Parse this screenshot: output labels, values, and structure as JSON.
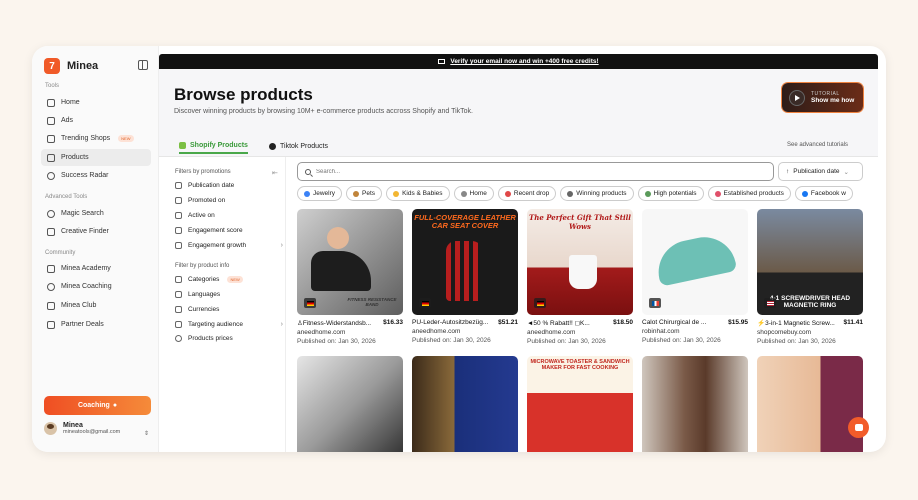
{
  "brand": {
    "name": "Minea",
    "logo_char": "7"
  },
  "sidebar": {
    "tools_label": "Tools",
    "tools": [
      {
        "label": "Home",
        "icon": "home-icon"
      },
      {
        "label": "Ads",
        "icon": "ads-icon"
      },
      {
        "label": "Trending Shops",
        "icon": "shop-icon",
        "badge": "NEW"
      },
      {
        "label": "Products",
        "icon": "products-icon",
        "active": true
      },
      {
        "label": "Success Radar",
        "icon": "radar-icon"
      }
    ],
    "advanced_label": "Advanced Tools",
    "advanced": [
      {
        "label": "Magic Search",
        "icon": "magic-icon"
      },
      {
        "label": "Creative Finder",
        "icon": "creative-icon"
      }
    ],
    "community_label": "Community",
    "community": [
      {
        "label": "Minea Academy",
        "icon": "academy-icon"
      },
      {
        "label": "Minea Coaching",
        "icon": "coaching-icon"
      },
      {
        "label": "Minea Club",
        "icon": "club-icon"
      },
      {
        "label": "Partner Deals",
        "icon": "deals-icon"
      }
    ],
    "coaching_button": "Coaching",
    "user": {
      "name": "Minea",
      "email": "mineatools@gmail.com"
    }
  },
  "banner": {
    "text": "Verify your email now and win +400 free credits!"
  },
  "header": {
    "title": "Browse products",
    "subtitle": "Discover winning products by browsing 10M+ e-commerce products accross Shopify and TikTok.",
    "tutorial_small": "TUTORIAL",
    "tutorial_big": "Show me how",
    "see_advanced": "See advanced tutorials"
  },
  "tabs": [
    {
      "label": "Shopify Products",
      "active": true
    },
    {
      "label": "Tiktok Products",
      "active": false
    }
  ],
  "filters": {
    "promotions_label": "Filters by promotions",
    "promotions": [
      {
        "label": "Publication date"
      },
      {
        "label": "Promoted on"
      },
      {
        "label": "Active on"
      },
      {
        "label": "Engagement score"
      },
      {
        "label": "Engagement growth",
        "chevron": true
      }
    ],
    "info_label": "Filter by product info",
    "info": [
      {
        "label": "Categories",
        "badge": "NEW"
      },
      {
        "label": "Languages"
      },
      {
        "label": "Currencies"
      },
      {
        "label": "Targeting audience",
        "chevron": true
      },
      {
        "label": "Products prices"
      }
    ]
  },
  "search": {
    "placeholder": "Search...",
    "sort_label": "Publication date"
  },
  "chips": [
    {
      "label": "Jewelry",
      "color": "#3b82f6"
    },
    {
      "label": "Pets",
      "color": "#c0843a"
    },
    {
      "label": "Kids & Babies",
      "color": "#f2b632"
    },
    {
      "label": "Home",
      "color": "#888888"
    },
    {
      "label": "Recent drop",
      "color": "#e04848"
    },
    {
      "label": "Winning products",
      "color": "#666666"
    },
    {
      "label": "High potentials",
      "color": "#5a9a5a"
    },
    {
      "label": "Established products",
      "color": "#e0506a"
    },
    {
      "label": "Facebook w",
      "color": "#1877f2"
    }
  ],
  "products": [
    {
      "title": "♙Fitness-Widerstandsb...",
      "price": "$16.33",
      "domain": "aneedhome.com",
      "published": "Published on: Jan 30, 2026",
      "flag": "DE",
      "overlay": "FITNESS RESISTANCE BAND"
    },
    {
      "title": "PU-Leder-Autositzbezüg...",
      "price": "$51.21",
      "domain": "aneedhome.com",
      "published": "Published on: Jan 30, 2026",
      "flag": "DE",
      "overlay": "FULL-COVERAGE LEATHER CAR SEAT COVER"
    },
    {
      "title": "◄50 % Rabatt!! ◻K...",
      "price": "$18.50",
      "domain": "aneedhome.com",
      "published": "Published on: Jan 30, 2026",
      "flag": "DE",
      "overlay": "The Perfect Gift That Still Wows"
    },
    {
      "title": "Calot Chirurgical de ...",
      "price": "$15.95",
      "domain": "robinhat.com",
      "published": "Published on: Jan 30, 2026",
      "flag": "FR",
      "overlay": ""
    },
    {
      "title": "⚡3-in-1 Magnetic Screw...",
      "price": "$11.41",
      "domain": "shopcomebuy.com",
      "published": "Published on: Jan 30, 2026",
      "flag": "US",
      "overlay": "4-1 SCREWDRIVER HEAD MAGNETIC RING"
    },
    {
      "title": "",
      "price": "",
      "domain": "",
      "published": "",
      "flag": "",
      "overlay": ""
    },
    {
      "title": "",
      "price": "",
      "domain": "",
      "published": "",
      "flag": "",
      "overlay": ""
    },
    {
      "title": "",
      "price": "",
      "domain": "",
      "published": "",
      "flag": "",
      "overlay": "MICROWAVE TOASTER & SANDWICH MAKER FOR FAST COOKING"
    },
    {
      "title": "",
      "price": "",
      "domain": "",
      "published": "",
      "flag": "",
      "overlay": ""
    },
    {
      "title": "",
      "price": "",
      "domain": "",
      "published": "",
      "flag": "",
      "overlay": ""
    }
  ]
}
